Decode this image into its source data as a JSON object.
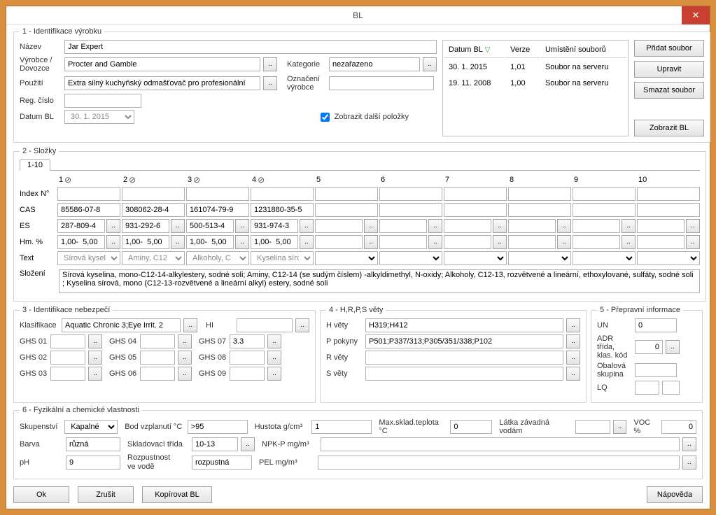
{
  "window": {
    "title": "BL",
    "close": "✕"
  },
  "sec1": {
    "legend": "1 - Identifikace výrobku",
    "nazev_lbl": "Název",
    "nazev": "Jar Expert",
    "vyrobce_lbl": "Výrobce /\nDovozce",
    "vyrobce": "Procter and Gamble",
    "kategorie_lbl": "Kategorie",
    "kategorie": "nezařazeno",
    "pouziti_lbl": "Použití",
    "pouziti": "Extra silný kuchyňský odmašťovač pro profesionální",
    "oznaceni_lbl": "Označení\nvýrobce",
    "oznaceni": "",
    "regcislo_lbl": "Reg. číslo",
    "regcislo": "",
    "datumbl_lbl": "Datum BL",
    "datumbl": "30.  1. 2015",
    "zobrazit_chk": "Zobrazit další položky",
    "ell": "..",
    "table": {
      "h1": "Datum BL",
      "h2": "Verze",
      "h3": "Umístění souborů",
      "r1c1": "30. 1. 2015",
      "r1c2": "1,01",
      "r1c3": "Soubor na serveru",
      "r2c1": "19. 11. 2008",
      "r2c2": "1,00",
      "r2c3": "Soubor na serveru"
    },
    "btns": {
      "pridat": "Přidat soubor",
      "upravit": "Upravit",
      "smazat": "Smazat soubor",
      "zobrazit": "Zobrazit BL"
    }
  },
  "sec2": {
    "legend": "2 - Složky",
    "tab": "1-10",
    "heads": {
      "c1": "1",
      "c2": "2",
      "c3": "3",
      "c4": "4",
      "c5": "5",
      "c6": "6",
      "c7": "7",
      "c8": "8",
      "c9": "9",
      "c10": "10"
    },
    "deny": "⊘",
    "rows": {
      "index": "Index N°",
      "cas": "CAS",
      "es": "ES",
      "hm": "Hm. %",
      "text": "Text",
      "slozeni_lbl": "Složení"
    },
    "cas1": "85586-07-8",
    "cas2": "308062-28-4",
    "cas3": "161074-79-9",
    "cas4": "1231880-35-5",
    "es1": "287-809-4",
    "es2": "931-292-6",
    "es3": "500-513-4",
    "es4": "931-974-3",
    "hm1": "1,00-  5,00",
    "hm2": "1,00-  5,00",
    "hm3": "1,00-  5,00",
    "hm4": "1,00-  5,00",
    "tx1": "Sírová kysel",
    "tx2": "Aminy, C12",
    "tx3": "Alkoholy, C",
    "tx4": "Kyselina síro",
    "ell": "..",
    "slozeni": "Sírová kyselina, mono-C12-14-alkylestery, sodné soli; Aminy, C12-14 (se sudým číslem) -alkyldimethyl, N-oxidy; Alkoholy, C12-13, rozvětvené a lineární, ethoxylované, sulfáty, sodné soli ; Kyselina sírová, mono (C12-13-rozvětvené a lineární alkyl) estery, sodné soli"
  },
  "sec3": {
    "legend": "3 - Identifikace nebezpečí",
    "klas_lbl": "Klasifikace",
    "klas": "Aquatic Chronic 3;Eye Irrit. 2",
    "hi_lbl": "HI",
    "hi": "",
    "ghs": {
      "g01": "GHS 01",
      "g02": "GHS 02",
      "g03": "GHS 03",
      "g04": "GHS 04",
      "g05": "GHS 05",
      "g06": "GHS 06",
      "g07": "GHS 07",
      "g07v": "3.3",
      "g08": "GHS 08",
      "g09": "GHS 09"
    },
    "ell": ".."
  },
  "sec4": {
    "legend": "4 - H,R,P,S věty",
    "h_lbl": "H věty",
    "h": "H319;H412",
    "p_lbl": "P pokyny",
    "p": "P501;P337/313;P305/351/338;P102",
    "r_lbl": "R věty",
    "r": "",
    "s_lbl": "S věty",
    "s": "",
    "ell": ".."
  },
  "sec5": {
    "legend": "5 - Přepravní informace",
    "un_lbl": "UN",
    "un": "0",
    "adr_lbl": "ADR třída,\nklas. kód",
    "adr": "0",
    "obal_lbl": "Obalová\nskupina",
    "obal": "",
    "lq_lbl": "LQ",
    "lq": "",
    "ell": ".."
  },
  "sec6": {
    "legend": "6 - Fyzikální a chemické vlastnosti",
    "skup_lbl": "Skupenství",
    "skup": "Kapalné",
    "bod_lbl": "Bod vzplanutí °C",
    "bod": ">95",
    "hust_lbl": "Hustota g/cm³",
    "hust": "1",
    "max_lbl": "Max.sklad.teplota °C",
    "max": "0",
    "latka_lbl": "Látka závadná vodám",
    "latka": "",
    "voc_lbl": "VOC %",
    "voc": "0",
    "barva_lbl": "Barva",
    "barva": "různá",
    "sklad_lbl": "Skladovací třída",
    "sklad": "10-13",
    "npk_lbl": "NPK-P mg/m³",
    "npk": "",
    "ph_lbl": "pH",
    "ph": "9",
    "rozp_lbl": "Rozpustnost\nve vodě",
    "rozp": "rozpustná",
    "pel_lbl": "PEL mg/m³",
    "pel": "",
    "ell": ".."
  },
  "footer": {
    "ok": "Ok",
    "zrusit": "Zrušit",
    "kopirovat": "Kopírovat BL",
    "napoveda": "Nápověda"
  }
}
